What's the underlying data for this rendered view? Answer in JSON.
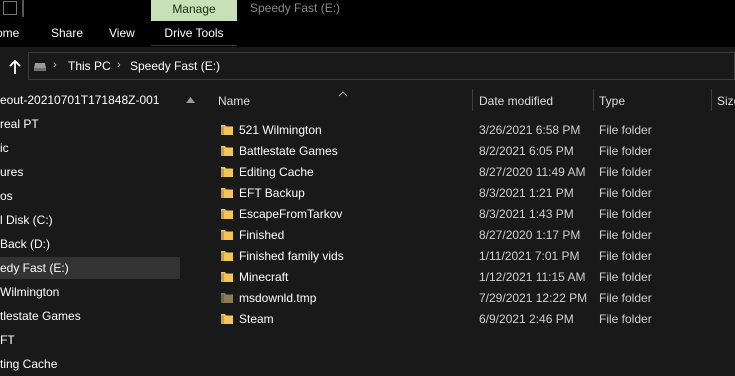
{
  "titlebar": {
    "manage_tab": "Manage",
    "window_title": "Speedy Fast (E:)"
  },
  "ribbon": {
    "tabs": [
      "ome",
      "Share",
      "View",
      "Drive Tools"
    ]
  },
  "address": {
    "crumbs": [
      "This PC",
      "Speedy Fast (E:)"
    ]
  },
  "nav": {
    "items": [
      "eout-20210701T171848Z-001",
      "real PT",
      "ic",
      "ures",
      "os",
      "l Disk (C:)",
      "Back (D:)",
      "edy Fast (E:)",
      " Wilmington",
      "tlestate Games",
      "FT",
      "ting Cache"
    ],
    "selected_index": 7
  },
  "columns": {
    "name": "Name",
    "date": "Date modified",
    "type": "Type",
    "size": "Size"
  },
  "files": [
    {
      "name": "521 Wilmington",
      "date": "3/26/2021 6:58 PM",
      "type": "File folder",
      "icon": "folder-icon"
    },
    {
      "name": "Battlestate Games",
      "date": "8/2/2021 6:05 PM",
      "type": "File folder",
      "icon": "folder-icon"
    },
    {
      "name": "Editing Cache",
      "date": "8/27/2020 11:49 AM",
      "type": "File folder",
      "icon": "folder-icon"
    },
    {
      "name": "EFT Backup",
      "date": "8/3/2021 1:21 PM",
      "type": "File folder",
      "icon": "folder-icon"
    },
    {
      "name": "EscapeFromTarkov",
      "date": "8/3/2021 1:43 PM",
      "type": "File folder",
      "icon": "folder-icon"
    },
    {
      "name": "Finished",
      "date": "8/27/2020 1:17 PM",
      "type": "File folder",
      "icon": "folder-icon"
    },
    {
      "name": "Finished family vids",
      "date": "1/11/2021 7:01 PM",
      "type": "File folder",
      "icon": "folder-icon"
    },
    {
      "name": "Minecraft",
      "date": "1/12/2021 11:15 AM",
      "type": "File folder",
      "icon": "folder-icon"
    },
    {
      "name": "msdownld.tmp",
      "date": "7/29/2021 12:22 PM",
      "type": "File folder",
      "icon": "folder-gray-icon"
    },
    {
      "name": "Steam",
      "date": "6/9/2021 2:46 PM",
      "type": "File folder",
      "icon": "folder-icon"
    }
  ],
  "colors": {
    "folder": "#f2c55c",
    "folder_tmp": "#8b7d55",
    "manage_tab": "#c7e0b7",
    "selected": "#333333"
  }
}
